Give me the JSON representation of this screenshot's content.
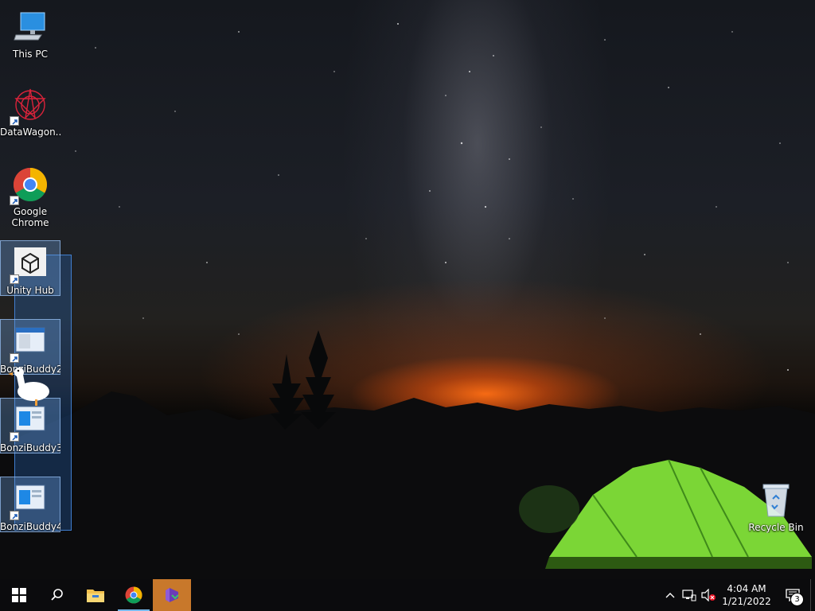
{
  "desktop": {
    "icons": [
      {
        "label": "This PC",
        "icon": "computer-icon"
      },
      {
        "label": "DataWagon...",
        "icon": "datawagon-icon"
      },
      {
        "label": "Google Chrome",
        "icon": "chrome-icon"
      },
      {
        "label": "Unity Hub",
        "icon": "unity-hub-icon"
      },
      {
        "label": "BonziBuddy2",
        "icon": "window-app-icon"
      },
      {
        "label": "BonziBuddy3",
        "icon": "window-app-icon"
      },
      {
        "label": "BonziBuddy4",
        "icon": "window-app-icon"
      },
      {
        "label": "Recycle Bin",
        "icon": "recycle-bin-icon"
      }
    ]
  },
  "taskbar": {
    "pinned": [
      "start-icon",
      "search-icon",
      "file-explorer-icon",
      "chrome-icon",
      "visual-studio-installer-icon"
    ],
    "clock": {
      "time": "4:04 AM",
      "date": "1/21/2022"
    },
    "notifications": {
      "count": "3"
    }
  },
  "colors": {
    "taskbar": "#0b0b0d",
    "accent": "#76b9ed",
    "highlight": "#c8782b"
  }
}
